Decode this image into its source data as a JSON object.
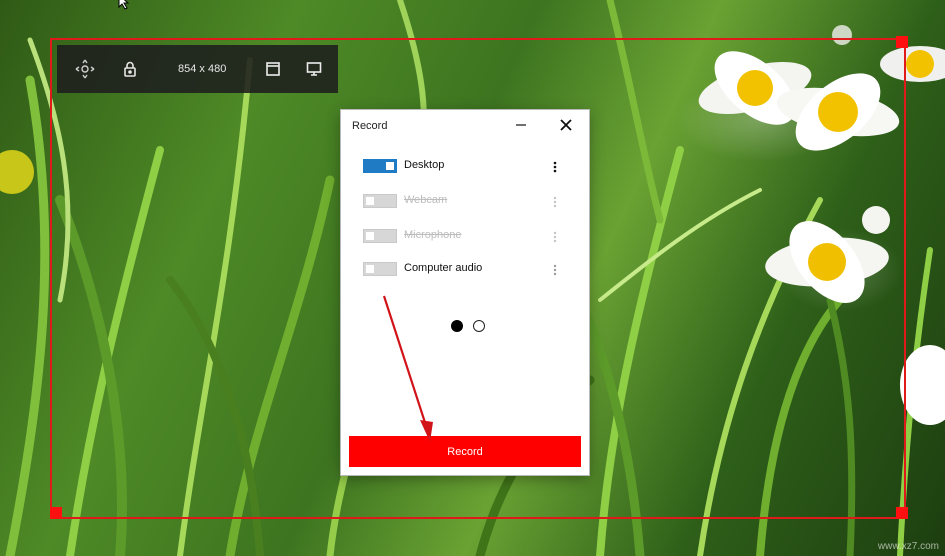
{
  "toolbar": {
    "size_label": "854 x 480",
    "icons": [
      "move-icon",
      "lock-icon",
      "window-icon",
      "monitor-icon"
    ]
  },
  "dialog": {
    "title": "Record",
    "sources": [
      {
        "label": "Desktop",
        "enabled": true,
        "available": true
      },
      {
        "label": "Webcam",
        "enabled": false,
        "available": false
      },
      {
        "label": "Microphone",
        "enabled": false,
        "available": false
      },
      {
        "label": "Computer audio",
        "enabled": false,
        "available": true
      }
    ],
    "page_indicator": {
      "current": 1,
      "total": 2
    },
    "record_button": "Record"
  },
  "colors": {
    "frame": "#e0191b",
    "toggle_on": "#1e7bc4",
    "record_button": "#ff0000"
  },
  "watermark": "www.xz7.com"
}
